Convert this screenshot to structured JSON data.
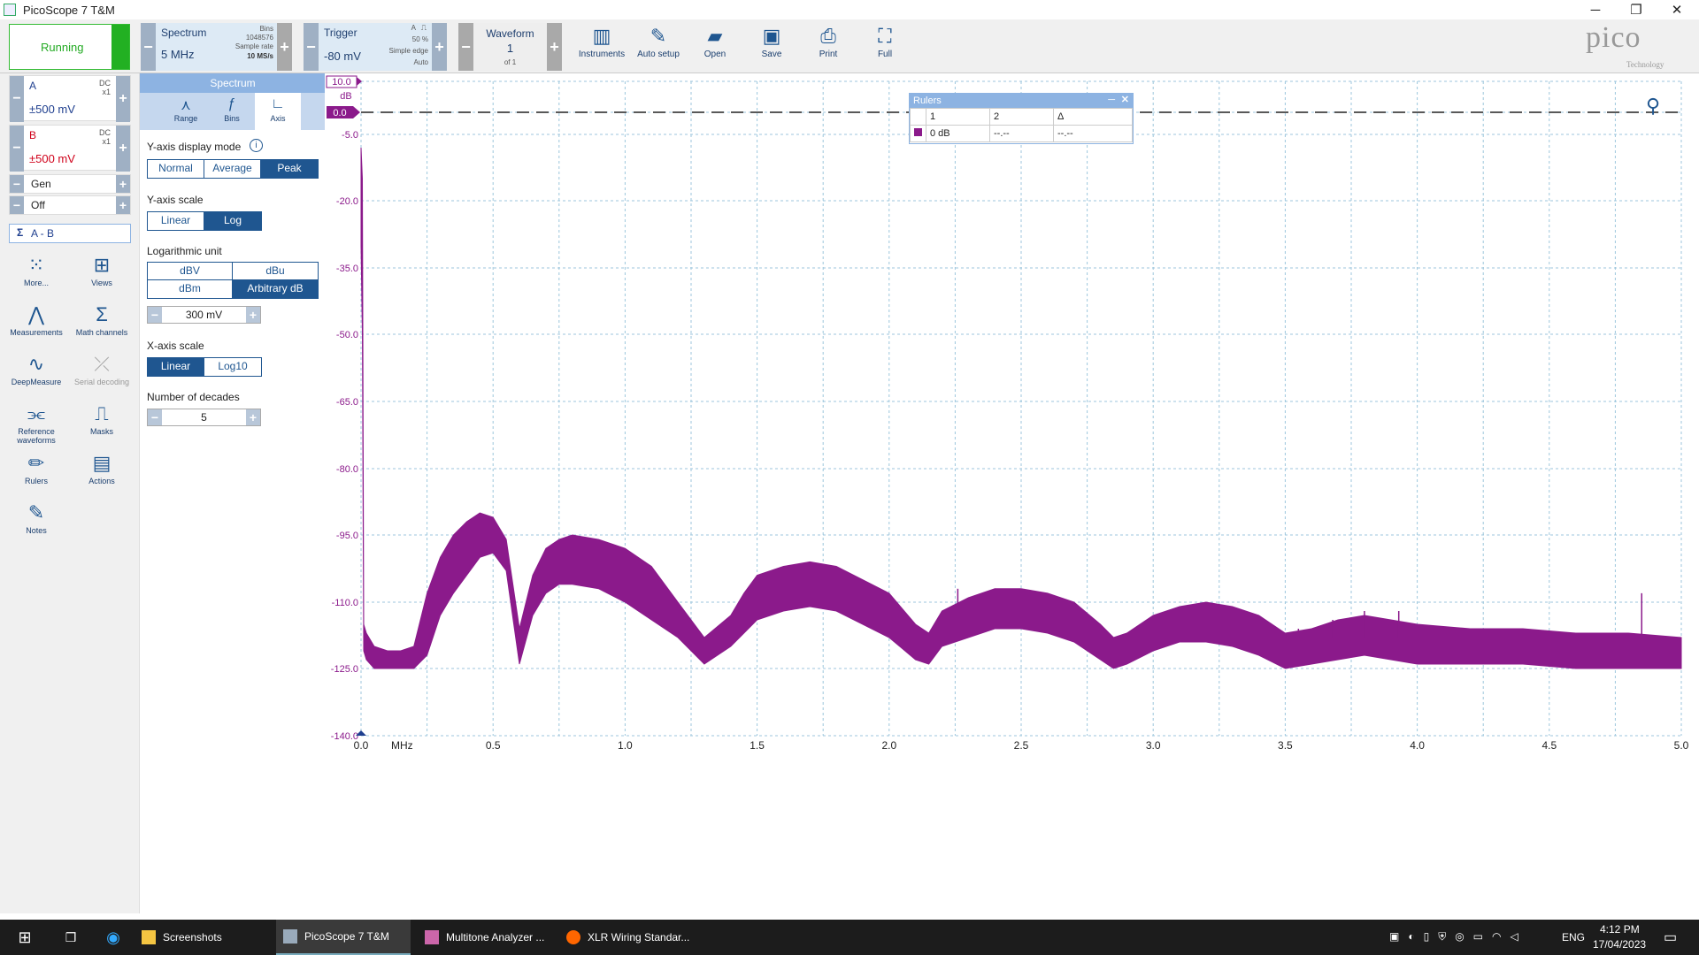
{
  "window": {
    "title": "PicoScope 7 T&M",
    "minimize": "─",
    "maximize": "❐",
    "close": "✕"
  },
  "toolbar": {
    "run_label": "Running",
    "spectrum_title": "Spectrum",
    "spectrum_value": "5 MHz",
    "bins_label": "Bins",
    "bins_value": "1048576",
    "sample_rate_label": "Sample rate",
    "sample_rate_value": "10 MS/s",
    "trigger_title": "Trigger",
    "trigger_value": "-80 mV",
    "trigger_channel": "A",
    "trigger_percent": "50 %",
    "trigger_type": "Simple edge",
    "trigger_mode": "Auto",
    "waveform_title": "Waveform",
    "waveform_value": "1",
    "waveform_of": "of 1",
    "tools": [
      {
        "name": "instruments",
        "label": "Instruments",
        "icon": "instruments-icon"
      },
      {
        "name": "auto-setup",
        "label": "Auto setup",
        "icon": "wand-icon"
      },
      {
        "name": "open",
        "label": "Open",
        "icon": "folder-icon"
      },
      {
        "name": "save",
        "label": "Save",
        "icon": "save-icon"
      },
      {
        "name": "print",
        "label": "Print",
        "icon": "printer-icon"
      },
      {
        "name": "full",
        "label": "Full",
        "icon": "fullscreen-icon"
      }
    ],
    "logo": "pico",
    "logo_sub": "Technology"
  },
  "channels": [
    {
      "name": "A",
      "coupling": "DC",
      "probe": "x1",
      "range": "±500 mV",
      "color": "#1f3f8f"
    },
    {
      "name": "B",
      "coupling": "DC",
      "probe": "x1",
      "range": "±500 mV",
      "color": "#d0021b"
    }
  ],
  "generator": {
    "label": "Gen",
    "state": "Off"
  },
  "math": {
    "label": "A - B"
  },
  "sidebar_tools": [
    {
      "label": "More...",
      "icon": "grid-dots-icon"
    },
    {
      "label": "Views",
      "icon": "views-icon"
    },
    {
      "label": "Measurements",
      "icon": "measurements-icon"
    },
    {
      "label": "Math channels",
      "icon": "sigma-icon"
    },
    {
      "label": "DeepMeasure",
      "icon": "deepmeasure-icon"
    },
    {
      "label": "Serial decoding",
      "icon": "serial-decoding-icon"
    },
    {
      "label": "Reference waveforms",
      "icon": "reference-waveforms-icon"
    },
    {
      "label": "Masks",
      "icon": "masks-icon"
    },
    {
      "label": "Rulers",
      "icon": "ruler-icon"
    },
    {
      "label": "Actions",
      "icon": "actions-icon"
    },
    {
      "label": "Notes",
      "icon": "notes-icon"
    }
  ],
  "panel": {
    "header": "Spectrum",
    "tabs": [
      {
        "label": "Range"
      },
      {
        "label": "Bins"
      },
      {
        "label": "Axis"
      }
    ],
    "y_display_label": "Y-axis display mode",
    "y_display_options": [
      "Normal",
      "Average",
      "Peak"
    ],
    "y_display_selected": "Peak",
    "y_scale_label": "Y-axis scale",
    "y_scale_options": [
      "Linear",
      "Log"
    ],
    "y_scale_selected": "Log",
    "log_unit_label": "Logarithmic unit",
    "log_unit_options": [
      "dBV",
      "dBu",
      "dBm",
      "Arbitrary dB"
    ],
    "log_unit_selected": "Arbitrary dB",
    "ref_value": "300 mV",
    "x_scale_label": "X-axis scale",
    "x_scale_options": [
      "Linear",
      "Log10"
    ],
    "x_scale_selected": "Linear",
    "decades_label": "Number of decades",
    "decades_value": "5"
  },
  "rulers_panel": {
    "title": "Rulers",
    "col1": "1",
    "col2": "2",
    "col3": "Δ",
    "row_label": "0 dB",
    "row_v2": "--.--",
    "row_v3": "--.--"
  },
  "chart_data": {
    "type": "line",
    "title": "",
    "xlabel": "MHz",
    "ylabel": "dB",
    "xlim": [
      0,
      5
    ],
    "ylim": [
      -140,
      10
    ],
    "y_ticks": [
      "10.0",
      "0.0",
      "-5.0",
      "-20.0",
      "-35.0",
      "-50.0",
      "-65.0",
      "-80.0",
      "-95.0",
      "-110.0",
      "-125.0",
      "-140.0"
    ],
    "y_tick_values": [
      10,
      0,
      -5,
      -20,
      -35,
      -50,
      -65,
      -80,
      -95,
      -110,
      -125,
      -140
    ],
    "x_ticks": [
      "0.0",
      "0.5",
      "1.0",
      "1.5",
      "2.0",
      "2.5",
      "3.0",
      "3.5",
      "4.0",
      "4.5",
      "5.0"
    ],
    "x_tick_values": [
      0,
      0.5,
      1.0,
      1.5,
      2.0,
      2.5,
      3.0,
      3.5,
      4.0,
      4.5,
      5.0
    ],
    "grid": true,
    "reference_line_db": 0,
    "series": [
      {
        "name": "A - B",
        "color": "#8b1a8b",
        "x": [
          0.0,
          0.005,
          0.01,
          0.02,
          0.05,
          0.1,
          0.15,
          0.2,
          0.25,
          0.3,
          0.35,
          0.4,
          0.45,
          0.5,
          0.55,
          0.6,
          0.65,
          0.7,
          0.75,
          0.8,
          0.9,
          1.0,
          1.1,
          1.2,
          1.3,
          1.4,
          1.45,
          1.5,
          1.6,
          1.7,
          1.8,
          1.9,
          2.0,
          2.1,
          2.15,
          2.2,
          2.3,
          2.4,
          2.5,
          2.6,
          2.7,
          2.8,
          2.85,
          2.9,
          3.0,
          3.1,
          3.2,
          3.3,
          3.4,
          3.5,
          3.6,
          3.7,
          3.8,
          3.9,
          4.0,
          4.2,
          4.4,
          4.6,
          4.8,
          5.0
        ],
        "y_upper": [
          -8.0,
          -15.0,
          -115.0,
          -117.0,
          -120.0,
          -121.0,
          -121.0,
          -120.0,
          -108.0,
          -100.0,
          -95.0,
          -92.0,
          -90.0,
          -91.0,
          -96.0,
          -116.0,
          -104.0,
          -98.0,
          -96.0,
          -95.0,
          -96.0,
          -98.0,
          -102.0,
          -110.0,
          -118.0,
          -113.0,
          -108.0,
          -104.0,
          -102.0,
          -101.0,
          -102.0,
          -105.0,
          -108.0,
          -115.0,
          -117.0,
          -112.0,
          -109.0,
          -107.0,
          -107.0,
          -108.0,
          -110.0,
          -115.0,
          -118.0,
          -117.0,
          -113.0,
          -111.0,
          -110.0,
          -111.0,
          -113.0,
          -117.0,
          -116.0,
          -114.0,
          -113.0,
          -114.0,
          -115.0,
          -116.0,
          -116.0,
          -117.0,
          -117.0,
          -118.0
        ],
        "y_lower": [
          -30.0,
          -50.0,
          -121.0,
          -123.0,
          -125.0,
          -125.0,
          -125.0,
          -125.0,
          -122.0,
          -113.0,
          -108.0,
          -104.0,
          -100.0,
          -99.0,
          -103.0,
          -124.0,
          -113.0,
          -108.0,
          -106.0,
          -106.0,
          -107.0,
          -110.0,
          -114.0,
          -118.0,
          -124.0,
          -120.0,
          -117.0,
          -114.0,
          -112.0,
          -111.0,
          -112.0,
          -115.0,
          -118.0,
          -123.0,
          -124.0,
          -120.0,
          -118.0,
          -116.0,
          -116.0,
          -117.0,
          -119.0,
          -123.0,
          -125.0,
          -124.0,
          -121.0,
          -119.0,
          -119.0,
          -120.0,
          -122.0,
          -125.0,
          -124.0,
          -123.0,
          -122.0,
          -123.0,
          -124.0,
          -124.0,
          -124.0,
          -125.0,
          -125.0,
          -125.0
        ]
      }
    ],
    "spurs": [
      {
        "x": 2.26,
        "y": -107.0
      },
      {
        "x": 3.5,
        "y": -117.0
      },
      {
        "x": 3.55,
        "y": -116.0
      },
      {
        "x": 3.68,
        "y": -114.0
      },
      {
        "x": 3.8,
        "y": -112.0
      },
      {
        "x": 3.93,
        "y": -112.0
      },
      {
        "x": 4.85,
        "y": -108.0
      }
    ]
  },
  "taskbar": {
    "items": [
      {
        "label": "Screenshots",
        "color": "#f4c542"
      },
      {
        "label": "PicoScope 7 T&M",
        "color": "#9ab"
      },
      {
        "label": "Multitone Analyzer ...",
        "color": "#c6a"
      },
      {
        "label": "XLR Wiring Standar...",
        "color": "#f60"
      }
    ],
    "lang": "ENG",
    "time": "4:12 PM",
    "date": "17/04/2023"
  }
}
